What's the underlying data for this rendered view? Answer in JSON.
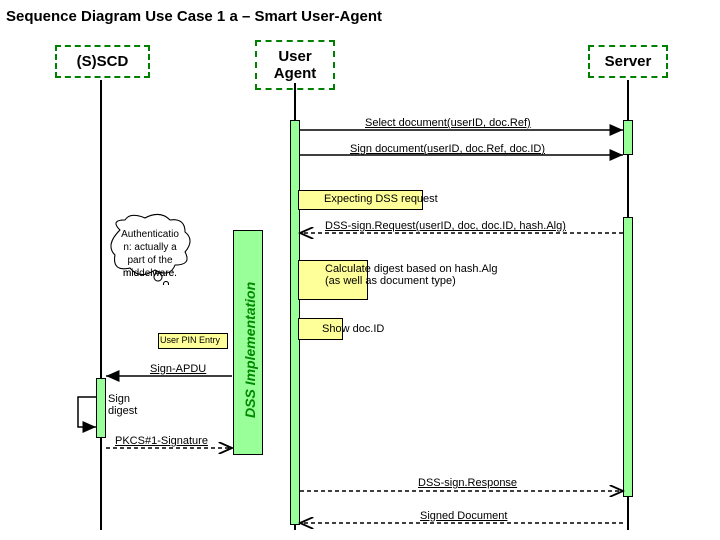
{
  "title": "Sequence Diagram Use Case 1 a – Smart User-Agent",
  "participants": {
    "sscd": "(S)SCD",
    "user_agent": "User\nAgent",
    "server": "Server"
  },
  "messages": {
    "select_doc": "Select document(userID, doc.Ref)",
    "sign_doc": "Sign document(userID, doc.Ref, doc.ID)",
    "expecting": "Expecting DSS request",
    "dss_sign_req": "DSS-sign.Request(userID, doc, doc.ID, hash.Alg)",
    "calc_digest": "Calculate digest based on hash.Alg\n(as well as document type)",
    "show_docid": "Show doc.ID",
    "user_pin": "User PIN Entry",
    "sign_apdu": "Sign-APDU",
    "sign_digest": "Sign\ndigest",
    "pkcs": "PKCS#1-Signature",
    "dss_sign_resp": "DSS-sign.Response",
    "signed_doc": "Signed Document"
  },
  "notes": {
    "auth_note": "Authenticatio\nn: actually a\npart of the\nmiddelware.",
    "dss_impl": "DSS Implementation"
  }
}
